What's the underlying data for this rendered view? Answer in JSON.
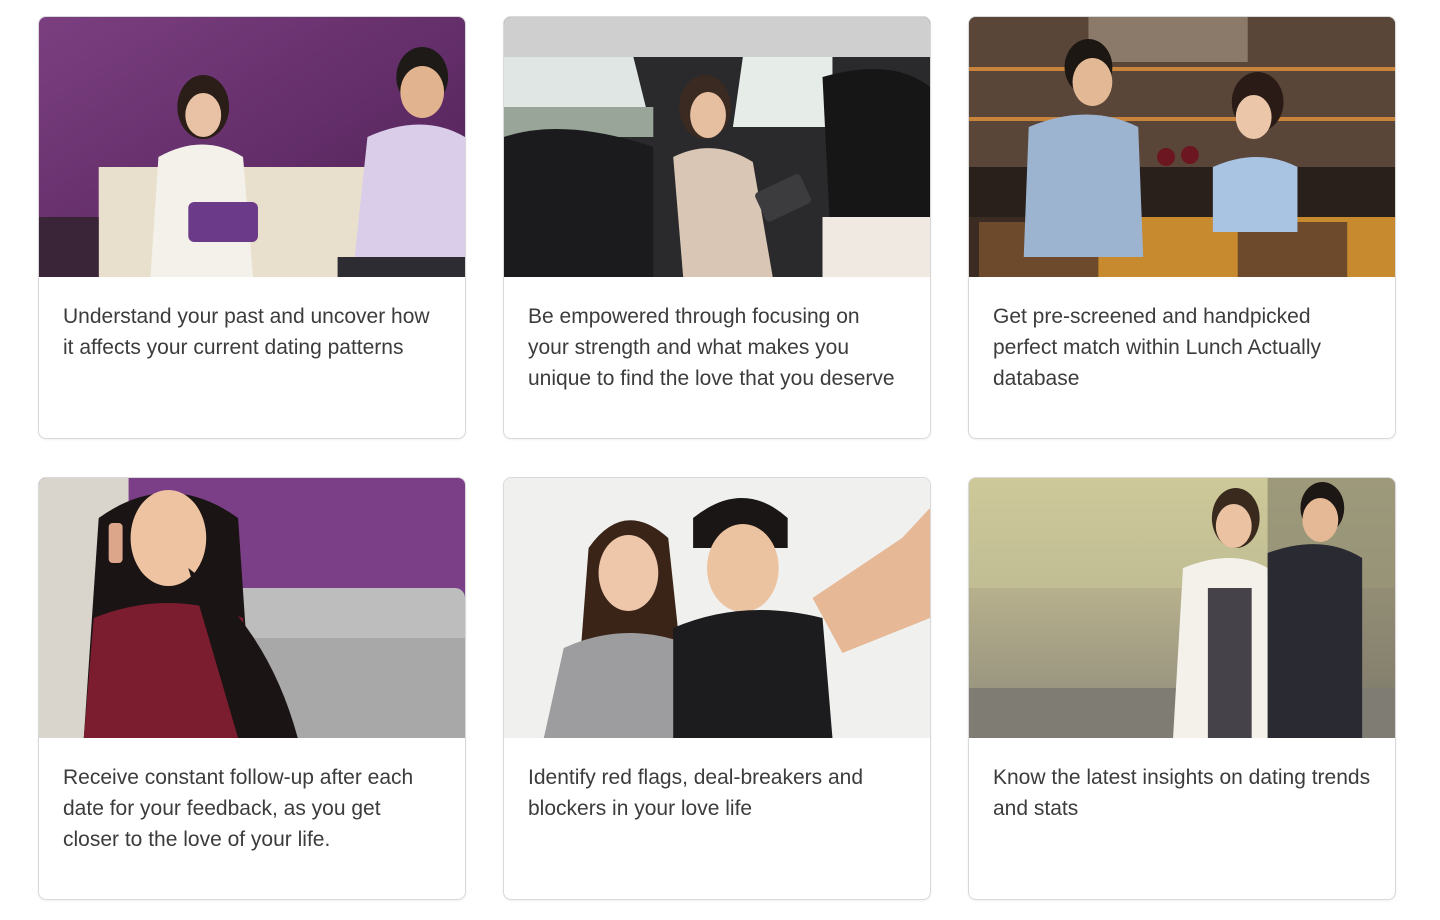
{
  "cards": [
    {
      "text": "Understand your past and uncover how it affects your current dating patterns",
      "image": "coaching-session-photo"
    },
    {
      "text": "Be empowered through focusing on your strength and what makes you unique to find the love that you deserve",
      "image": "woman-in-car-photo"
    },
    {
      "text": "Get pre-screened and handpicked perfect match within Lunch Actually database",
      "image": "couple-wine-bar-photo"
    },
    {
      "text": "Receive constant follow-up after each date for your feedback, as you get closer to the love of your life.",
      "image": "woman-on-phone-photo"
    },
    {
      "text": "Identify red flags, deal-breakers and blockers in your love life",
      "image": "couple-selfie-photo"
    },
    {
      "text": "Know the latest insights on dating trends and stats",
      "image": "couple-walking-photo"
    }
  ],
  "colors": {
    "purple_wall": "#6a2f6e",
    "card_border": "#d9d9d9",
    "text": "#3c3c3c"
  }
}
